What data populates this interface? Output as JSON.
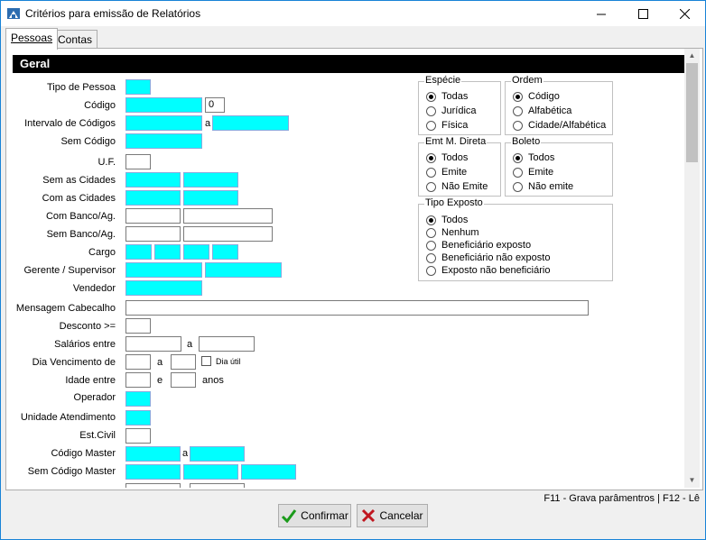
{
  "window": {
    "title": "Critérios para emissão de Relatórios"
  },
  "tabs": [
    {
      "label": "Pessoas"
    },
    {
      "label": "Contas"
    }
  ],
  "section_title": "Geral",
  "fields": {
    "tipo_pessoa": "Tipo de Pessoa",
    "codigo": "Código",
    "codigo_value": "0",
    "intervalo_codigos": "Intervalo de Códigos",
    "sem_codigo": "Sem Código",
    "uf": "U.F.",
    "sem_cidades": "Sem as Cidades",
    "com_cidades": "Com as Cidades",
    "com_banco": "Com Banco/Ag.",
    "sem_banco": "Sem Banco/Ag.",
    "cargo": "Cargo",
    "gerente": "Gerente / Supervisor",
    "vendedor": "Vendedor",
    "mensagem": "Mensagem Cabecalho",
    "desconto": "Desconto >=",
    "salarios": "Salários entre",
    "dia_venc": "Dia Vencimento de",
    "dia_util": "Dia útil",
    "idade": "Idade entre",
    "anos": "anos",
    "operador": "Operador",
    "unidade": "Unidade Atendimento",
    "est_civil": "Est.Civil",
    "codigo_master": "Código Master",
    "sem_codigo_master": "Sem Código Master",
    "sep_a": "a",
    "sep_e": "e"
  },
  "groups": {
    "especie": {
      "title": "Espécie",
      "options": [
        "Todas",
        "Jurídica",
        "Física"
      ],
      "selected": 0
    },
    "ordem": {
      "title": "Ordem",
      "options": [
        "Código",
        "Alfabética",
        "Cidade/Alfabética"
      ],
      "selected": 0
    },
    "emt": {
      "title": "Emt M. Direta",
      "options": [
        "Todos",
        "Emite",
        "Não Emite"
      ],
      "selected": 0
    },
    "boleto": {
      "title": "Boleto",
      "options": [
        "Todos",
        "Emite",
        "Não emite"
      ],
      "selected": 0
    },
    "tipo_exposto": {
      "title": "Tipo Exposto",
      "options": [
        "Todos",
        "Nenhum",
        "Beneficiário exposto",
        "Beneficiário não exposto",
        "Exposto não beneficiário"
      ],
      "selected": 0
    }
  },
  "status": "F11 - Grava parâmentros | F12 - Lê",
  "buttons": {
    "confirm": "Confirmar",
    "cancel": "Cancelar"
  },
  "colors": {
    "highlight_field": "#00ffff",
    "section_bar": "#000000",
    "window_border": "#1883d7"
  }
}
